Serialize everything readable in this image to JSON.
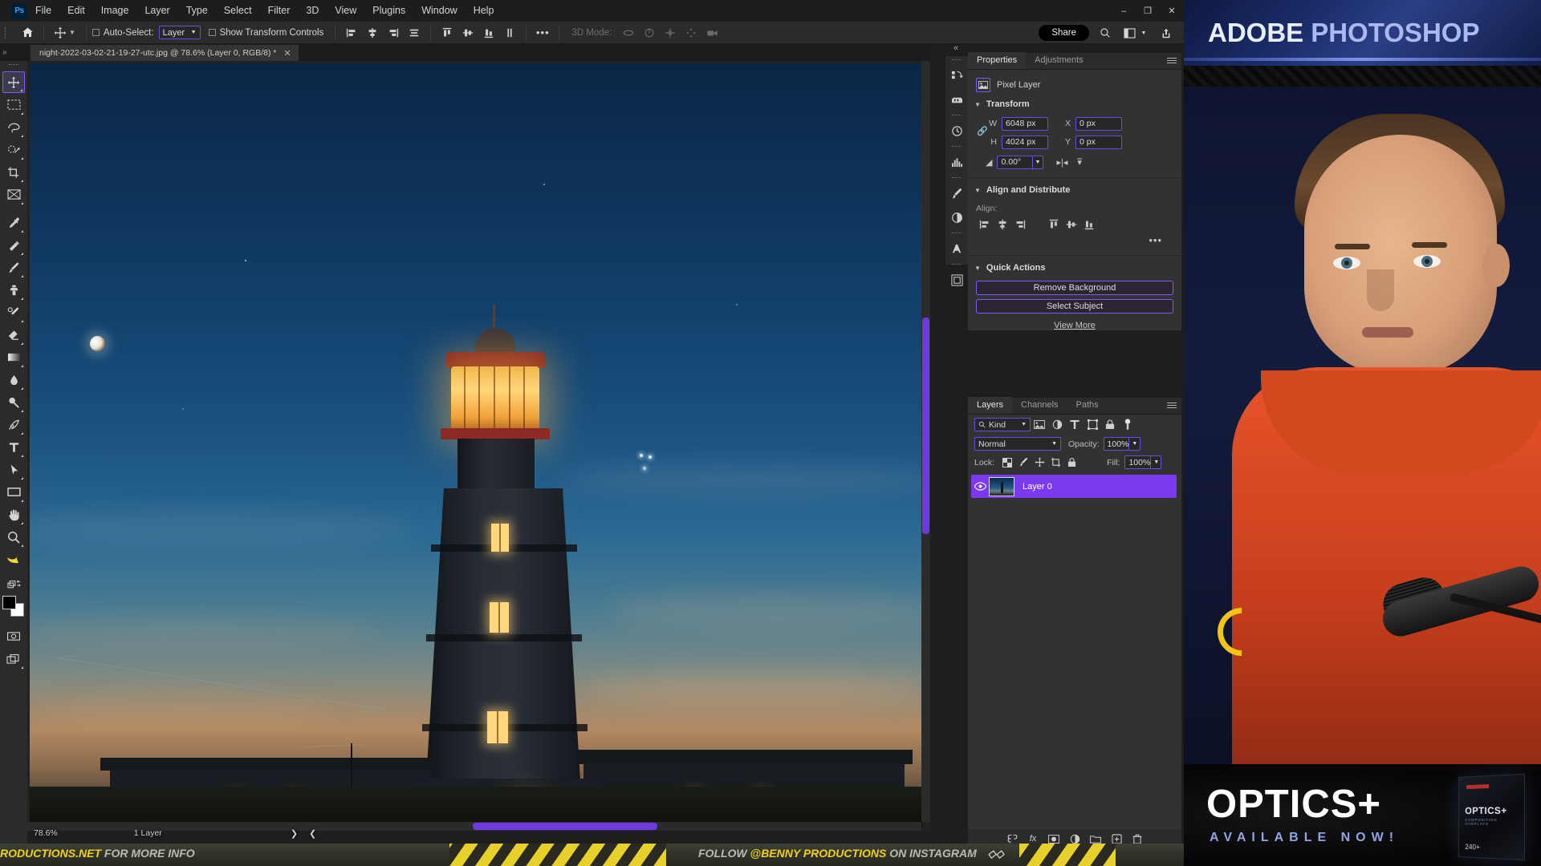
{
  "app": {
    "name": "Adobe Photoshop",
    "logo_text": "Ps",
    "menus": [
      "File",
      "Edit",
      "Image",
      "Layer",
      "Type",
      "Select",
      "Filter",
      "3D",
      "View",
      "Plugins",
      "Window",
      "Help"
    ],
    "window_controls": {
      "minimize": "–",
      "maximize": "❐",
      "close": "✕"
    }
  },
  "options_bar": {
    "home_icon": "home-icon",
    "tool_icon": "move-tool-icon",
    "auto_select_label": "Auto-Select:",
    "auto_select_checked": false,
    "auto_select_value": "Layer",
    "show_transform_label": "Show Transform Controls",
    "show_transform_checked": false,
    "three_d_mode_label": "3D Mode:",
    "more_label": "•••",
    "share_label": "Share",
    "right_icons": [
      "search-icon",
      "workspace-icon",
      "chevron-down-icon",
      "share-export-icon"
    ]
  },
  "tab_strip": {
    "expand_label": "»",
    "document_title": "night-2022-03-02-21-19-27-utc.jpg @ 78.6% (Layer 0, RGB/8) *",
    "close_label": "✕"
  },
  "toolbar": {
    "tools": [
      {
        "name": "move-tool",
        "selected": true
      },
      {
        "name": "rectangular-marquee-tool",
        "selected": false
      },
      {
        "name": "lasso-tool",
        "selected": false
      },
      {
        "name": "object-selection-tool",
        "selected": false
      },
      {
        "name": "crop-tool",
        "selected": false
      },
      {
        "name": "frame-tool",
        "selected": false
      },
      {
        "name": "eyedropper-tool",
        "selected": false
      },
      {
        "name": "spot-healing-brush-tool",
        "selected": false
      },
      {
        "name": "brush-tool",
        "selected": false
      },
      {
        "name": "clone-stamp-tool",
        "selected": false
      },
      {
        "name": "history-brush-tool",
        "selected": false
      },
      {
        "name": "eraser-tool",
        "selected": false
      },
      {
        "name": "gradient-tool",
        "selected": false
      },
      {
        "name": "blur-tool",
        "selected": false
      },
      {
        "name": "dodge-tool",
        "selected": false
      },
      {
        "name": "pen-tool",
        "selected": false
      },
      {
        "name": "type-tool",
        "selected": false
      },
      {
        "name": "path-selection-tool",
        "selected": false
      },
      {
        "name": "rectangle-tool",
        "selected": false
      },
      {
        "name": "hand-tool",
        "selected": false
      },
      {
        "name": "zoom-tool",
        "selected": false
      },
      {
        "name": "banana-tool",
        "selected": false
      }
    ],
    "edit_toolbar_label": "•••",
    "foreground_color": "#000000",
    "background_color": "#ffffff",
    "quick_mask_name": "quick-mask-icon",
    "screen_mode_name": "screen-mode-icon"
  },
  "canvas": {
    "image_description": "Night photograph of a lit lighthouse with crescent moon at dusk",
    "vertical_scrollbar": "vertical-scrollbar",
    "horizontal_scrollbar": "horizontal-scrollbar"
  },
  "status_bar": {
    "zoom": "78.6%",
    "layer_count": "1 Layer",
    "next_arrow": "❯",
    "prev_arrow": "❮"
  },
  "dock_rail": {
    "icons": [
      "libraries-icon",
      "color-swatch-icon",
      "history-icon",
      "histogram-icon",
      "brushes-icon",
      "adjustments-icon",
      "character-icon",
      "glyphs-icon",
      "patterns-icon"
    ]
  },
  "properties_panel": {
    "collapse_label": "«",
    "tabs": [
      {
        "label": "Properties",
        "active": true
      },
      {
        "label": "Adjustments",
        "active": false
      }
    ],
    "layer_type": "Pixel Layer",
    "transform": {
      "title": "Transform",
      "w_label": "W",
      "w_value": "6048 px",
      "h_label": "H",
      "h_value": "4024 px",
      "x_label": "X",
      "x_value": "0 px",
      "y_label": "Y",
      "y_value": "0 px",
      "angle_value": "0.00°",
      "link_icon": "link-icon",
      "flip_h_icon": "flip-horizontal-icon",
      "flip_v_icon": "flip-vertical-icon"
    },
    "align": {
      "title": "Align and Distribute",
      "label": "Align:",
      "buttons": [
        "align-left-icon",
        "align-center-horizontal-icon",
        "align-right-icon",
        "align-top-icon",
        "align-center-vertical-icon",
        "align-bottom-icon"
      ],
      "more": "•••"
    },
    "quick_actions": {
      "title": "Quick Actions",
      "remove_background": "Remove Background",
      "select_subject": "Select Subject",
      "view_more": "View More"
    }
  },
  "layers_panel": {
    "tabs": [
      {
        "label": "Layers",
        "active": true
      },
      {
        "label": "Channels",
        "active": false
      },
      {
        "label": "Paths",
        "active": false
      }
    ],
    "filter_value": "Kind",
    "filter_icons": [
      "pixel-filter-icon",
      "adjustment-filter-icon",
      "type-filter-icon",
      "shape-filter-icon",
      "smart-object-filter-icon",
      "filter-toggle-icon"
    ],
    "blend_mode": "Normal",
    "opacity_label": "Opacity:",
    "opacity_value": "100%",
    "lock_label": "Lock:",
    "lock_icons": [
      "lock-transparent-pixels-icon",
      "lock-image-pixels-icon",
      "lock-position-icon",
      "lock-artboard-icon",
      "lock-all-icon"
    ],
    "fill_label": "Fill:",
    "fill_value": "100%",
    "layers": [
      {
        "name": "Layer 0",
        "visible": true,
        "selected": true
      }
    ],
    "bottom_icons": [
      "link-layers-icon",
      "layer-style-icon",
      "layer-mask-icon",
      "adjustment-layer-icon",
      "new-group-icon",
      "new-layer-icon",
      "delete-layer-icon"
    ]
  },
  "video_overlay": {
    "banner_word1": "ADOBE",
    "banner_word2": "PHOTOSHOP",
    "optics_title": "OPTICS+",
    "optics_subtitle": "AVAILABLE NOW!",
    "product_box": {
      "brand": "OPTICS+",
      "sub": "COMPOSITING OVERLAYS",
      "count": "240+"
    }
  },
  "ticker": {
    "left_yellow": "RODUCTIONS.NET",
    "left_white": "FOR MORE INFO",
    "right_white_1": "FOLLOW",
    "right_yellow": "@BENNY PRODUCTIONS",
    "right_white_2": "ON INSTAGRAM",
    "arrow": "◇◇"
  }
}
